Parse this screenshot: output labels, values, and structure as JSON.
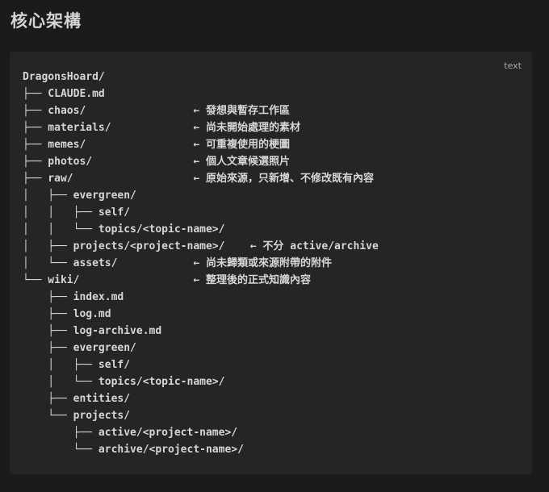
{
  "heading": "核心架構",
  "code_block": {
    "language": "text",
    "lines": [
      "DragonsHoard/",
      "├── CLAUDE.md",
      "├── chaos/                 ← 發想與暫存工作區",
      "├── materials/             ← 尚未開始處理的素材",
      "├── memes/                 ← 可重複使用的梗圖",
      "├── photos/                ← 個人文章候選照片",
      "├── raw/                   ← 原始來源，只新增、不修改既有內容",
      "│   ├── evergreen/",
      "│   │   ├── self/",
      "│   │   └── topics/<topic-name>/",
      "│   ├── projects/<project-name>/    ← 不分 active/archive",
      "│   └── assets/            ← 尚未歸類或來源附帶的附件",
      "└── wiki/                  ← 整理後的正式知識內容",
      "    ├── index.md",
      "    ├── log.md",
      "    ├── log-archive.md",
      "    ├── evergreen/",
      "    │   ├── self/",
      "    │   └── topics/<topic-name>/",
      "    ├── entities/",
      "    └── projects/",
      "        ├── active/<project-name>/",
      "        └── archive/<project-name>/"
    ]
  }
}
